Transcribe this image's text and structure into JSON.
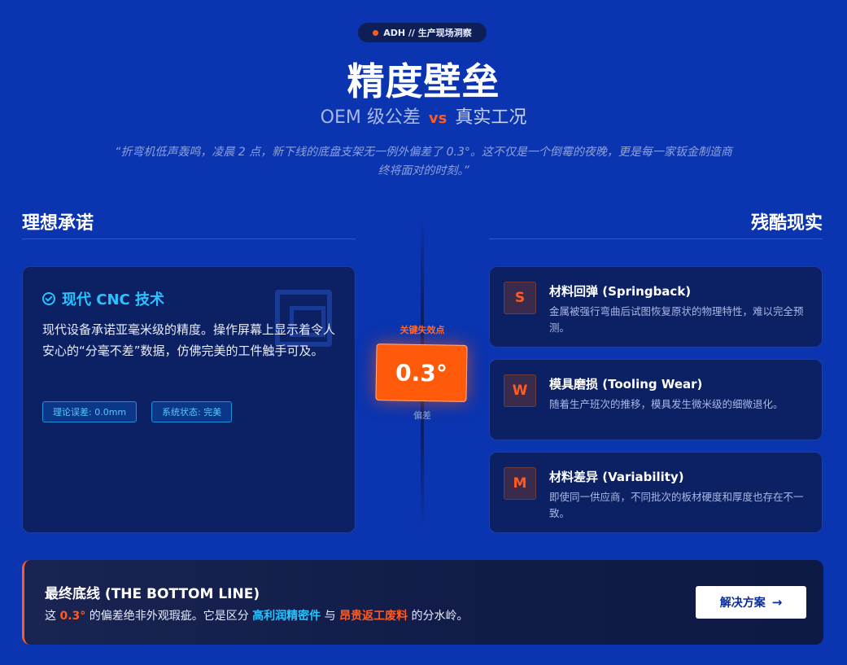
{
  "header": {
    "badge": "ADH // 生产现场洞察",
    "title": "精度壁垒",
    "subtitle_left": "OEM 级公差",
    "subtitle_vs": "vs",
    "subtitle_right": "真实工况",
    "quote": "“折弯机低声轰鸣，凌晨 2 点，新下线的底盘支架无一例外偏差了 0.3°。这不仅是一个倒霉的夜晚，更是每一家钣金制造商终将面对的时刻。”"
  },
  "left_column": {
    "heading": "理想承诺",
    "card": {
      "title": "现代 CNC 技术",
      "body": "现代设备承诺亚毫米级的精度。操作屏幕上显示着令人安心的“分毫不差”数据，仿佛完美的工件触手可及。",
      "chips": [
        "理论误差: 0.0mm",
        "系统状态: 完美"
      ]
    }
  },
  "center": {
    "label": "关键失效点",
    "value": "0.3°",
    "sub": "偏差"
  },
  "right_column": {
    "heading": "残酷现实",
    "items": [
      {
        "letter": "S",
        "title": "材料回弹 (Springback)",
        "desc": "金属被强行弯曲后试图恢复原状的物理特性，难以完全预测。"
      },
      {
        "letter": "W",
        "title": "模具磨损 (Tooling Wear)",
        "desc": "随着生产班次的推移，模具发生微米级的细微退化。"
      },
      {
        "letter": "M",
        "title": "材料差异 (Variability)",
        "desc": "即使同一供应商，不同批次的板材硬度和厚度也存在不一致。"
      }
    ]
  },
  "bottom": {
    "title": "最终底线 (THE BOTTOM LINE)",
    "part1": "这 ",
    "highlight1": "0.3°",
    "part2": " 的偏差绝非外观瑕疵。它是区分 ",
    "highlight2": "高利润精密件",
    "part3": " 与 ",
    "highlight3": "昂贵返工废料",
    "part4": " 的分水岭。",
    "cta_label": "解决方案",
    "cta_arrow": "→"
  },
  "colors": {
    "background": "#0a34b0",
    "accent_orange": "#ff5a1f",
    "accent_cyan": "#29c3ff",
    "card": "#0c2163"
  }
}
